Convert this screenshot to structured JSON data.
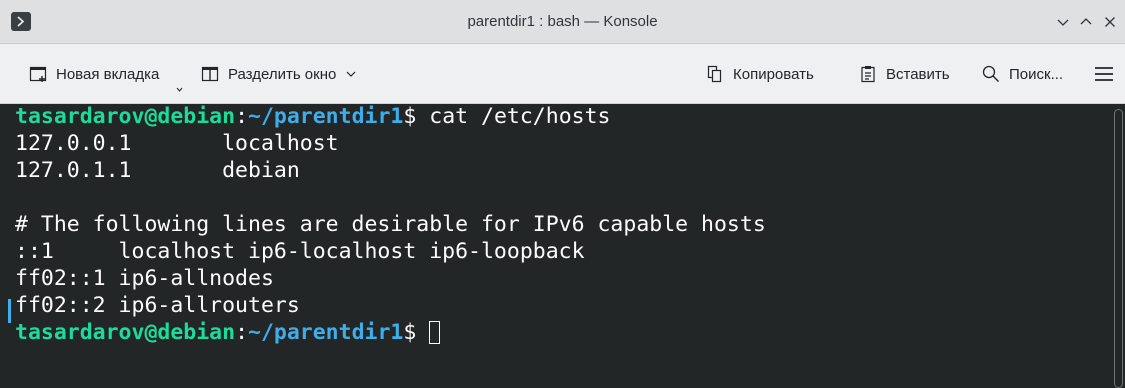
{
  "window": {
    "title": "parentdir1 : bash — Konsole"
  },
  "toolbar": {
    "new_tab": "Новая вкладка",
    "split": "Разделить окно",
    "copy": "Копировать",
    "paste": "Вставить",
    "search": "Поиск..."
  },
  "terminal": {
    "prompt_user": "tasardarov@debian",
    "prompt_colon": ":",
    "prompt_path": "~/parentdir1",
    "prompt_symbol": "$ ",
    "command": "cat /etc/hosts",
    "output": [
      "127.0.0.1       localhost",
      "127.0.1.1       debian",
      "",
      "# The following lines are desirable for IPv6 capable hosts",
      "::1     localhost ip6-localhost ip6-loopback",
      "ff02::1 ip6-allnodes",
      "ff02::2 ip6-allrouters"
    ]
  },
  "colors": {
    "prompt_user": "#1cdc9a",
    "prompt_path": "#3daee9",
    "terminal_bg": "#232627",
    "terminal_fg": "#fcfcfc"
  },
  "icons": [
    "konsole-app-icon",
    "chevron-down-icon",
    "chevron-up-icon",
    "close-icon",
    "new-tab-icon",
    "split-view-icon",
    "copy-icon",
    "paste-icon",
    "search-icon",
    "hamburger-menu-icon"
  ]
}
